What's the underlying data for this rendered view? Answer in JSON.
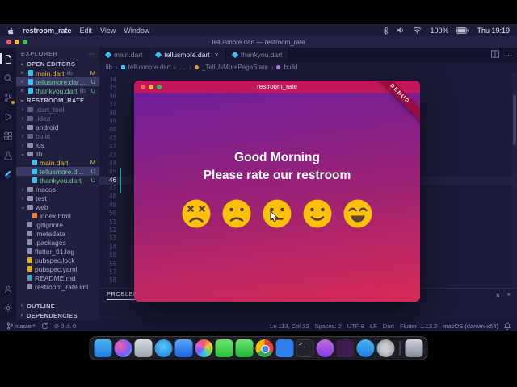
{
  "colors": {
    "app_titlebar": "#C2185B",
    "gradient_top": "#6E1E9C",
    "gradient_bottom": "#D92A55",
    "emoji_yellow": "#FFC107",
    "debug_ribbon": "#9B0A37",
    "dart_blue": "#3AC2F0"
  },
  "icons": {
    "chevron_right": "›",
    "chevron_down": "⌄",
    "ellipsis": "⋯",
    "close": "×",
    "collapse": "∧",
    "error": "⊘",
    "warning": "⚠"
  },
  "menu_bar": {
    "app_name": "restroom_rate",
    "menus": [
      "Edit",
      "View",
      "Window"
    ],
    "battery": "100%",
    "clock": "Thu 19:19"
  },
  "vscode": {
    "window_title": "tellusmore.dart — restroom_rate",
    "tabs": [
      {
        "label": "main.dart"
      },
      {
        "label": "tellusmore.dart"
      },
      {
        "label": "thankyou.dart"
      }
    ],
    "breadcrumb": [
      "lib",
      "tellusmore.dart",
      "…",
      "_TellUsMorePageState",
      "build"
    ],
    "explorer": {
      "title": "EXPLORER",
      "sections": {
        "open_editors": "OPEN EDITORS",
        "project": "RESTROOM_RATE",
        "outline": "OUTLINE",
        "dependencies": "DEPENDENCIES"
      },
      "open_editors": [
        {
          "label": "main.dart",
          "detail": "lib",
          "badge": "M"
        },
        {
          "label": "tellusmore.dar…",
          "detail": "",
          "badge": "U"
        },
        {
          "label": "thankyou.dart",
          "detail": "lib",
          "badge": "U"
        }
      ],
      "tree": [
        {
          "label": ".dart_tool"
        },
        {
          "label": ".idea"
        },
        {
          "label": "android"
        },
        {
          "label": "build"
        },
        {
          "label": "ios"
        },
        {
          "label": "lib"
        },
        {
          "label": "main.dart",
          "badge": "M"
        },
        {
          "label": "tellusmore.d…",
          "badge": "U"
        },
        {
          "label": "thankyou.dart",
          "badge": "U"
        },
        {
          "label": "macos"
        },
        {
          "label": "test"
        },
        {
          "label": "web"
        },
        {
          "label": "index.html"
        },
        {
          "label": ".gitignore"
        },
        {
          "label": ".metadata"
        },
        {
          "label": ".packages"
        },
        {
          "label": "flutter_01.log"
        },
        {
          "label": "pubspec.lock"
        },
        {
          "label": "pubspec.yaml"
        },
        {
          "label": "README.md"
        },
        {
          "label": "restroom_rate.iml"
        }
      ]
    },
    "editor": {
      "lines": [
        "34",
        "35",
        "36",
        "37",
        "38",
        "39",
        "40",
        "41",
        "42",
        "43",
        "44",
        "45",
        "46",
        "47",
        "48",
        "49",
        "50",
        "51",
        "52",
        "53",
        "54",
        "55",
        "56",
        "57",
        "58"
      ],
      "current_line": "46"
    },
    "panel": {
      "problems_label": "PROBLEMS"
    },
    "status_bar": {
      "branch": "master*",
      "errors": "0",
      "warnings": "0",
      "line_col": "Ln 113, Col 32",
      "indent": "Spaces: 2",
      "encoding": "UTF-8",
      "eol": "LF",
      "language": "Dart",
      "flutter_version": "Flutter: 1.13.2",
      "platform": "macOS (darwin-x64)"
    }
  },
  "app_window": {
    "title": "restroom_rate",
    "debug_banner": "DEBUG",
    "greeting_line1": "Good Morning",
    "greeting_line2": "Please rate our restroom",
    "emojis": [
      {
        "name": "very-dissatisfied"
      },
      {
        "name": "dissatisfied"
      },
      {
        "name": "neutral"
      },
      {
        "name": "satisfied"
      },
      {
        "name": "very-satisfied"
      }
    ]
  },
  "dock": {
    "items": [
      {
        "name": "finder"
      },
      {
        "name": "siri"
      },
      {
        "name": "launchpad"
      },
      {
        "name": "safari"
      },
      {
        "name": "mail"
      },
      {
        "name": "photos"
      },
      {
        "name": "messages"
      },
      {
        "name": "facetime"
      },
      {
        "name": "chrome"
      },
      {
        "name": "vscode"
      },
      {
        "name": "terminal"
      },
      {
        "name": "music"
      },
      {
        "name": "slack"
      },
      {
        "name": "app-store"
      },
      {
        "name": "system-preferences"
      },
      {
        "name": "trash"
      }
    ]
  }
}
